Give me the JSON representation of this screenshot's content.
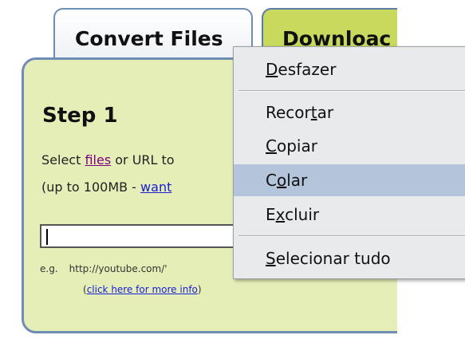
{
  "tabs": {
    "convert": "Convert Files",
    "download": "Downloac"
  },
  "panel": {
    "step_title": "Step 1",
    "select_prefix": "Select ",
    "select_link": "files",
    "select_suffix": " or URL to",
    "size_prefix": "(up to 100MB - ",
    "size_link": "want",
    "url_value": "",
    "example_label": "e.g.",
    "example_url": "http://youtube.com/'",
    "more_info_open": "(",
    "more_info_link": "click here for more info",
    "more_info_close": ")"
  },
  "context_menu": {
    "items": [
      {
        "pre": "",
        "key": "D",
        "post": "esfazer"
      },
      {
        "pre": "Recor",
        "key": "t",
        "post": "ar"
      },
      {
        "pre": "",
        "key": "C",
        "post": "opiar"
      },
      {
        "pre": "C",
        "key": "o",
        "post": "lar"
      },
      {
        "pre": "E",
        "key": "x",
        "post": "cluir"
      },
      {
        "pre": "",
        "key": "S",
        "post": "elecionar tudo"
      }
    ],
    "highlighted_item": "Colar"
  },
  "colors": {
    "panel_bg": "#e6eeb8",
    "download_tab_bg": "#c8d95d",
    "border_blue": "#6f8cb6",
    "menu_bg": "#e9eaec",
    "menu_highlight": "#b3c4db",
    "link": "#1a20d6",
    "visited_link": "#800080"
  }
}
